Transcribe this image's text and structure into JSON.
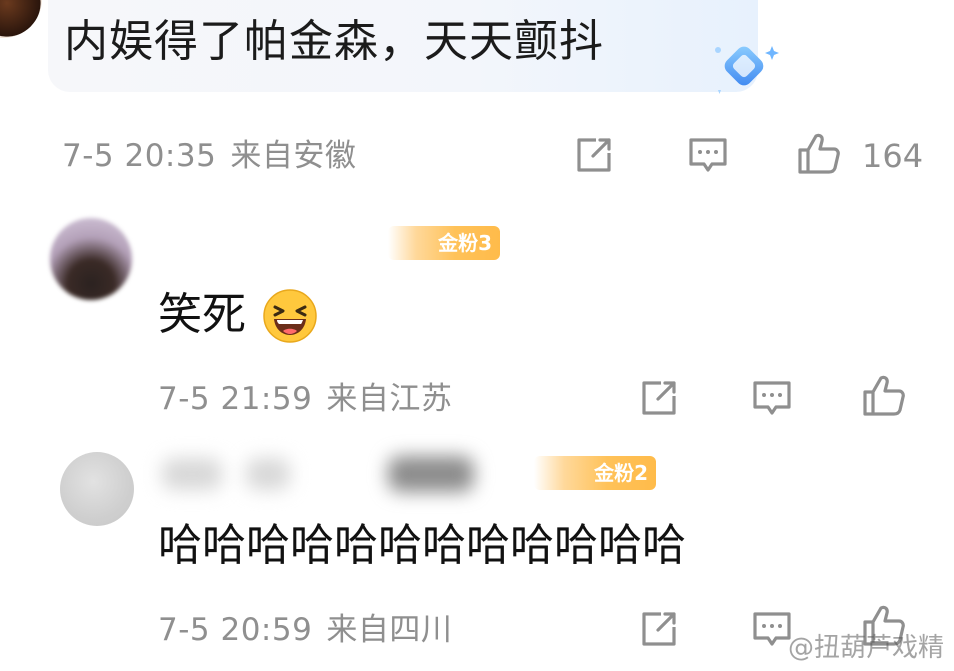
{
  "top_comment": {
    "text": "内娱得了帕金森，天天颤抖",
    "time": "7-5 20:35",
    "location": "来自安徽",
    "like_count": "164",
    "badge_icon": "diamond-icon"
  },
  "replies": [
    {
      "fan_badge": "金粉3",
      "text": "笑死",
      "emoji": "laughing-emoji",
      "time": "7-5 21:59",
      "location": "来自江苏"
    },
    {
      "fan_badge": "金粉2",
      "text": "哈哈哈哈哈哈哈哈哈哈哈哈",
      "time": "7-5 20:59",
      "location": "来自四川"
    }
  ],
  "icons": {
    "share": "share-icon",
    "comment": "comment-icon",
    "like": "thumbs-up-icon"
  },
  "colors": {
    "meta_text": "#8f8f8f",
    "badge_gold": "#ffc259",
    "diamond_blue": "#5aa8f5"
  },
  "watermark": "@扭葫芦戏精"
}
